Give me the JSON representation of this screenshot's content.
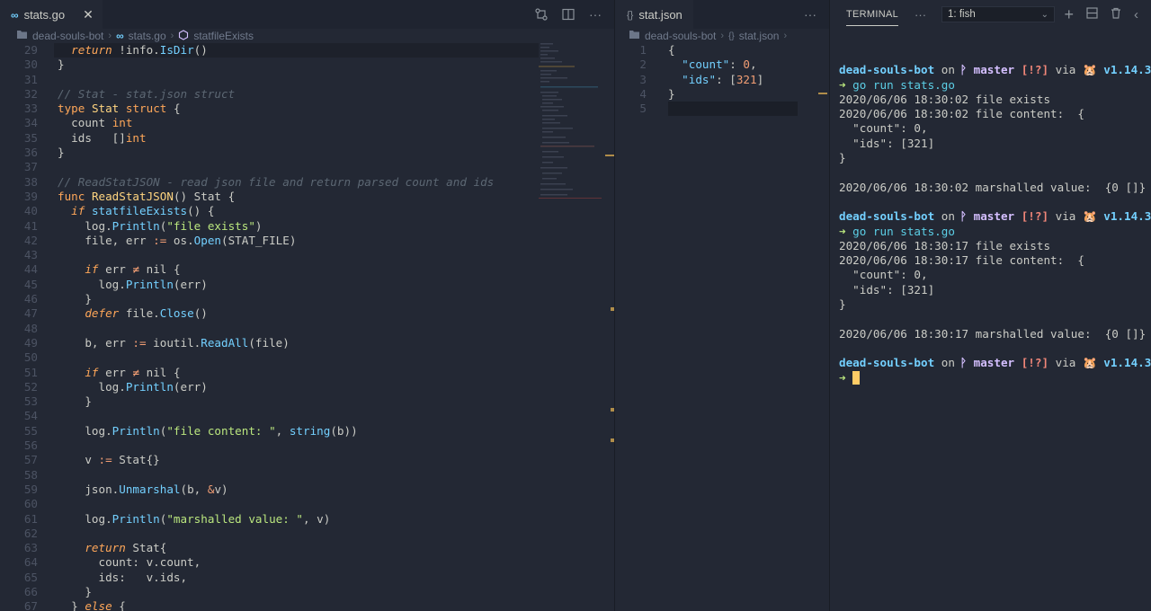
{
  "left_editor": {
    "tab": {
      "label": "stats.go",
      "icon": "go-icon"
    },
    "breadcrumb": [
      "dead-souls-bot",
      "stats.go",
      "statfileExists"
    ],
    "lines": [
      {
        "n": "29",
        "html": "  <span class=\"kwi\">return</span> !info.<span class=\"call\">IsDir</span>()",
        "current": true
      },
      {
        "n": "30",
        "html": "}"
      },
      {
        "n": "31",
        "html": ""
      },
      {
        "n": "32",
        "html": "<span class=\"cm\">// Stat - stat.json struct</span>"
      },
      {
        "n": "33",
        "html": "<span class=\"kw\">type</span> <span class=\"fn\">Stat</span> <span class=\"kw\">struct</span> {"
      },
      {
        "n": "34",
        "html": "  <span class=\"field\">count</span> <span class=\"tyint\">int</span>"
      },
      {
        "n": "35",
        "html": "  <span class=\"field\">ids</span>   []<span class=\"tyint\">int</span>"
      },
      {
        "n": "36",
        "html": "}"
      },
      {
        "n": "37",
        "html": ""
      },
      {
        "n": "38",
        "html": "<span class=\"cm\">// ReadStatJSON - read json file and return parsed count and ids</span>"
      },
      {
        "n": "39",
        "html": "<span class=\"kw\">func</span> <span class=\"fn\">ReadStatJSON</span>() Stat {"
      },
      {
        "n": "40",
        "html": "  <span class=\"kwi\">if</span> <span class=\"call\">statfileExists</span>() {"
      },
      {
        "n": "41",
        "html": "    log.<span class=\"call\">Println</span>(<span class=\"str\">\"file exists\"</span>)"
      },
      {
        "n": "42",
        "html": "    file, err <span class=\"op\">:=</span> os.<span class=\"call\">Open</span>(STAT_FILE)"
      },
      {
        "n": "43",
        "html": ""
      },
      {
        "n": "44",
        "html": "    <span class=\"kwi\">if</span> err <span class=\"op\">≠</span> nil {"
      },
      {
        "n": "45",
        "html": "      log.<span class=\"call\">Println</span>(err)"
      },
      {
        "n": "46",
        "html": "    }"
      },
      {
        "n": "47",
        "html": "    <span class=\"kwi\">defer</span> file.<span class=\"call\">Close</span>()"
      },
      {
        "n": "48",
        "html": ""
      },
      {
        "n": "49",
        "html": "    b, err <span class=\"op\">:=</span> ioutil.<span class=\"call\">ReadAll</span>(file)"
      },
      {
        "n": "50",
        "html": ""
      },
      {
        "n": "51",
        "html": "    <span class=\"kwi\">if</span> err <span class=\"op\">≠</span> nil {"
      },
      {
        "n": "52",
        "html": "      log.<span class=\"call\">Println</span>(err)"
      },
      {
        "n": "53",
        "html": "    }"
      },
      {
        "n": "54",
        "html": ""
      },
      {
        "n": "55",
        "html": "    log.<span class=\"call\">Println</span>(<span class=\"str\">\"file content: \"</span>, <span class=\"call\">string</span>(b))"
      },
      {
        "n": "56",
        "html": ""
      },
      {
        "n": "57",
        "html": "    v <span class=\"op\">:=</span> Stat{}"
      },
      {
        "n": "58",
        "html": ""
      },
      {
        "n": "59",
        "html": "    json.<span class=\"call\">Unmarshal</span>(b, <span class=\"op\">&amp;</span>v)"
      },
      {
        "n": "60",
        "html": ""
      },
      {
        "n": "61",
        "html": "    log.<span class=\"call\">Println</span>(<span class=\"str\">\"marshalled value: \"</span>, v)"
      },
      {
        "n": "62",
        "html": ""
      },
      {
        "n": "63",
        "html": "    <span class=\"kwi\">return</span> Stat{"
      },
      {
        "n": "64",
        "html": "      count: v.count,"
      },
      {
        "n": "65",
        "html": "      ids:   v.ids,"
      },
      {
        "n": "66",
        "html": "    }"
      },
      {
        "n": "67",
        "html": "  } <span class=\"kwi\">else</span> {"
      }
    ]
  },
  "mid_editor": {
    "tab": {
      "label": "stat.json",
      "icon": "json-braces-icon"
    },
    "breadcrumb": [
      "dead-souls-bot",
      "stat.json"
    ],
    "lines": [
      {
        "n": "1",
        "html": "{"
      },
      {
        "n": "2",
        "html": "  <span class=\"jkey\">\"count\"</span>: <span class=\"op\">0</span>,"
      },
      {
        "n": "3",
        "html": "  <span class=\"jkey\">\"ids\"</span>: [<span class=\"op\">321</span>]"
      },
      {
        "n": "4",
        "html": "}"
      },
      {
        "n": "5",
        "html": "",
        "current": true
      }
    ]
  },
  "terminal": {
    "title": "TERMINAL",
    "shell_select": "1: fish",
    "lines": [
      {
        "type": "blank"
      },
      {
        "type": "prompt",
        "dir": "dead-souls-bot",
        "on": " on ",
        "branch": " master",
        "status": " [!?]",
        "via": " via ",
        "emoji": "🐹",
        "ver": " v1.14.3"
      },
      {
        "type": "cmd",
        "arrow": "➜ ",
        "cmd": "go run stats.go"
      },
      {
        "type": "text",
        "text": "2020/06/06 18:30:02 file exists"
      },
      {
        "type": "text",
        "text": "2020/06/06 18:30:02 file content:  {"
      },
      {
        "type": "text",
        "text": "  \"count\": 0,"
      },
      {
        "type": "text",
        "text": "  \"ids\": [321]"
      },
      {
        "type": "text",
        "text": "}"
      },
      {
        "type": "blank"
      },
      {
        "type": "text",
        "text": "2020/06/06 18:30:02 marshalled value:  {0 []}"
      },
      {
        "type": "blank"
      },
      {
        "type": "prompt",
        "dir": "dead-souls-bot",
        "on": " on ",
        "branch": " master",
        "status": " [!?]",
        "via": " via ",
        "emoji": "🐹",
        "ver": " v1.14.3"
      },
      {
        "type": "cmd",
        "arrow": "➜ ",
        "cmd": "go run stats.go"
      },
      {
        "type": "text",
        "text": "2020/06/06 18:30:17 file exists"
      },
      {
        "type": "text",
        "text": "2020/06/06 18:30:17 file content:  {"
      },
      {
        "type": "text",
        "text": "  \"count\": 0,"
      },
      {
        "type": "text",
        "text": "  \"ids\": [321]"
      },
      {
        "type": "text",
        "text": "}"
      },
      {
        "type": "blank"
      },
      {
        "type": "text",
        "text": "2020/06/06 18:30:17 marshalled value:  {0 []}"
      },
      {
        "type": "blank"
      },
      {
        "type": "prompt",
        "dir": "dead-souls-bot",
        "on": " on ",
        "branch": " master",
        "status": " [!?]",
        "via": " via ",
        "emoji": "🐹",
        "ver": " v1.14.3"
      },
      {
        "type": "cursor",
        "arrow": "➜ "
      }
    ]
  },
  "colors": {
    "background": "#232834",
    "accent_yellow": "#ffcc66",
    "accent_cyan": "#73d0ff",
    "accent_orange": "#ffa759"
  }
}
